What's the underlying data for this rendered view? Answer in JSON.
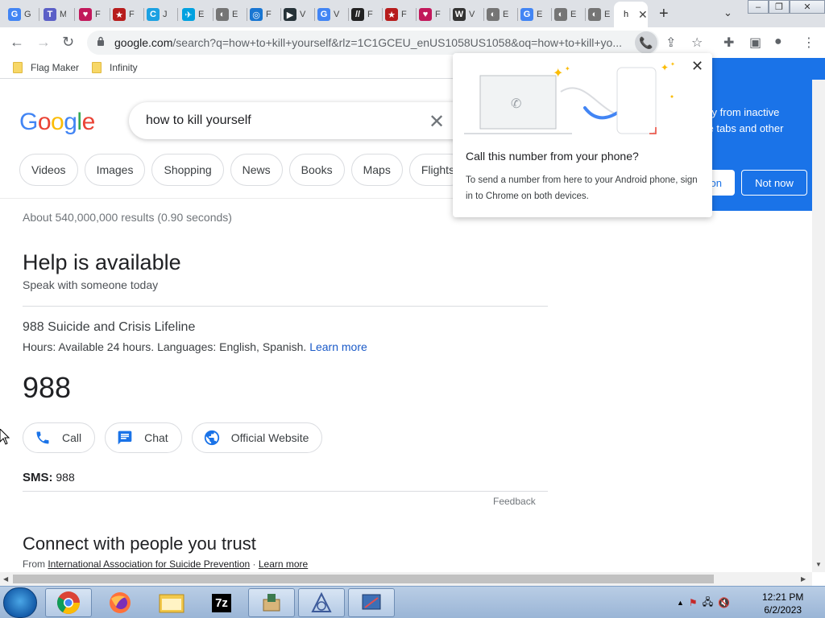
{
  "browser": {
    "tabs": [
      {
        "fav": "G",
        "color": "#4285f4",
        "label": "G"
      },
      {
        "fav": "T",
        "color": "#5b5fc7",
        "label": "M"
      },
      {
        "fav": "♥",
        "color": "#c2185b",
        "label": "F"
      },
      {
        "fav": "★",
        "color": "#b71c1c",
        "label": "F"
      },
      {
        "fav": "C",
        "color": "#1ba1e2",
        "label": "J"
      },
      {
        "fav": "✈",
        "color": "#00a1e0",
        "label": "E"
      },
      {
        "fav": "◐",
        "color": "#757575",
        "label": "E"
      },
      {
        "fav": "◎",
        "color": "#1976d2",
        "label": "F"
      },
      {
        "fav": "▶",
        "color": "#263238",
        "label": "V"
      },
      {
        "fav": "G",
        "color": "#4285f4",
        "label": "V"
      },
      {
        "fav": "//",
        "color": "#222222",
        "label": "F"
      },
      {
        "fav": "★",
        "color": "#b71c1c",
        "label": "F"
      },
      {
        "fav": "♥",
        "color": "#c2185b",
        "label": "F"
      },
      {
        "fav": "W",
        "color": "#333333",
        "label": "V"
      },
      {
        "fav": "◐",
        "color": "#757575",
        "label": "E"
      },
      {
        "fav": "G",
        "color": "#4285f4",
        "label": "E"
      },
      {
        "fav": "◐",
        "color": "#757575",
        "label": "E"
      },
      {
        "fav": "◐",
        "color": "#757575",
        "label": "E"
      }
    ],
    "active_tab_label": "h",
    "url_host": "google.com",
    "url_rest": "/search?q=how+to+kill+yourself&rlz=1C1GCEU_enUS1058US1058&oq=how+to+kill+yo...",
    "bookmarks": [
      "Flag Maker",
      "Infinity"
    ]
  },
  "search": {
    "logo_letters": [
      "G",
      "o",
      "o",
      "g",
      "l",
      "e"
    ],
    "logo_colors": [
      "#4285f4",
      "#ea4335",
      "#fbbc05",
      "#4285f4",
      "#34a853",
      "#ea4335"
    ],
    "query": "how to kill yourself",
    "chips": [
      "Videos",
      "Images",
      "Shopping",
      "News",
      "Books",
      "Maps",
      "Flights"
    ],
    "stats": "About 540,000,000 results (0.90 seconds)"
  },
  "help": {
    "title": "Help is available",
    "subtitle": "Speak with someone today",
    "org": "988 Suicide and Crisis Lifeline",
    "hours": "Hours: Available 24 hours. Languages: English, Spanish.",
    "learn_more": "Learn more",
    "number": "988",
    "actions": {
      "call": "Call",
      "chat": "Chat",
      "website": "Official Website"
    },
    "sms_label": "SMS:",
    "sms_value": "988",
    "feedback": "Feedback"
  },
  "connect": {
    "title": "Connect with people you trust",
    "from_prefix": "From",
    "source": "International Association for Suicide Prevention",
    "sep": "·",
    "learn_more": "Learn more"
  },
  "promo": {
    "line1": "ory from inactive",
    "line2": "ve tabs and other",
    "btn_partial": "on",
    "btn_not_now": "Not now"
  },
  "call_popup": {
    "title": "Call this number from your phone?",
    "body": "To send a number from here to your Android phone, sign in to Chrome on both devices."
  },
  "taskbar": {
    "apps": [
      "chrome-app",
      "firefox-app",
      "explorer-app",
      "7zip-app",
      "installer-app",
      "ai-app",
      "settings-app"
    ],
    "sevenzip_label": "7z",
    "time": "12:21 PM",
    "date": "6/2/2023"
  }
}
